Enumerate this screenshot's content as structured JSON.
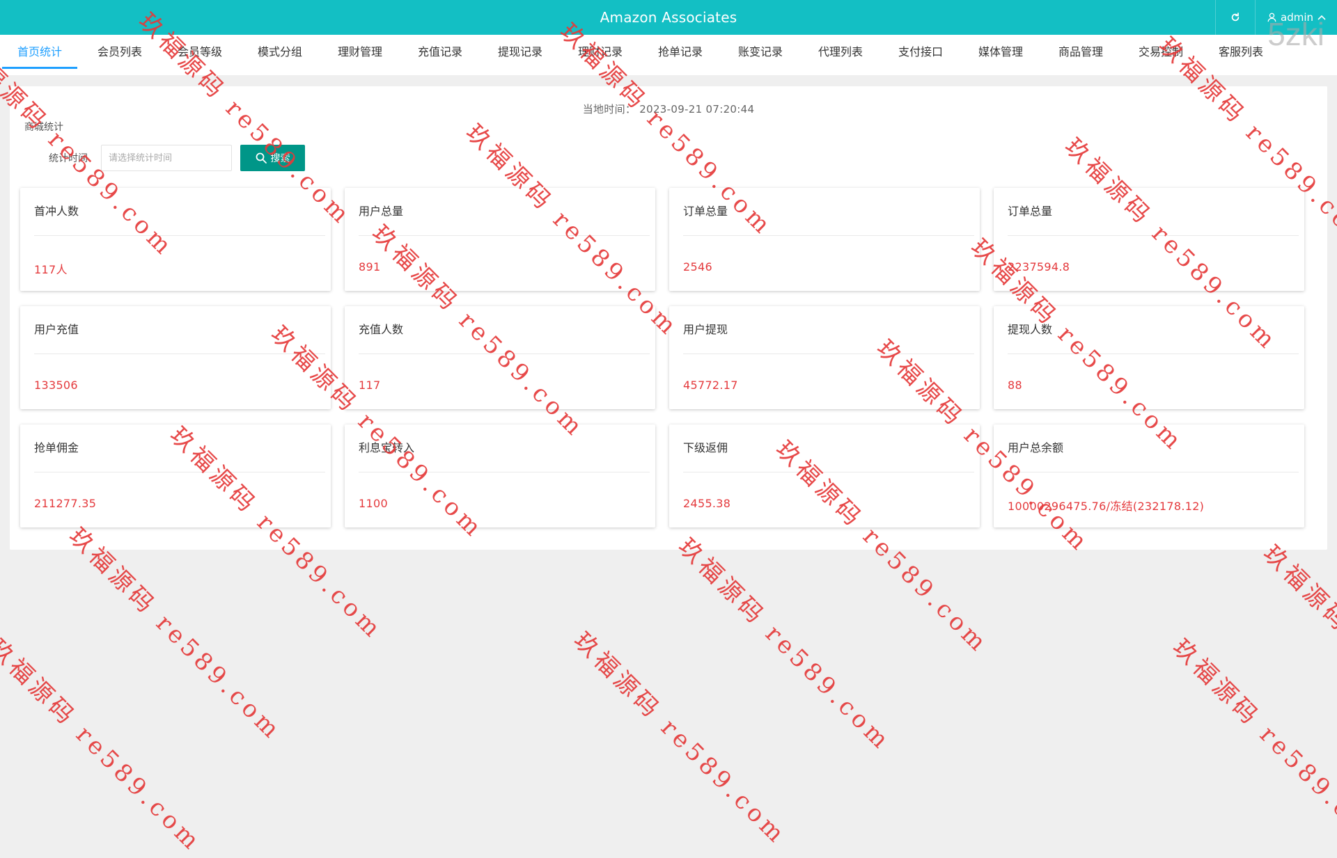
{
  "header": {
    "title": "Amazon Associates",
    "user": "admin"
  },
  "tabs": [
    {
      "label": "首页统计",
      "active": true
    },
    {
      "label": "会员列表"
    },
    {
      "label": "会员等级"
    },
    {
      "label": "模式分组"
    },
    {
      "label": "理财管理"
    },
    {
      "label": "充值记录"
    },
    {
      "label": "提现记录"
    },
    {
      "label": "理财记录"
    },
    {
      "label": "抢单记录"
    },
    {
      "label": "账变记录"
    },
    {
      "label": "代理列表"
    },
    {
      "label": "支付接口"
    },
    {
      "label": "媒体管理"
    },
    {
      "label": "商品管理"
    },
    {
      "label": "交易控制"
    },
    {
      "label": "客服列表"
    }
  ],
  "clock": {
    "label": "当地时间：",
    "value": "2023-09-21 07:20:44"
  },
  "section_label": "商城统计",
  "filter": {
    "label": "统计时间",
    "placeholder": "请选择统计时间",
    "value": ""
  },
  "search_button": "搜索",
  "cards": [
    {
      "title": "首冲人数",
      "value": "117人"
    },
    {
      "title": "用户总量",
      "value": "891"
    },
    {
      "title": "订单总量",
      "value": "2546"
    },
    {
      "title": "订单总量",
      "value": "2237594.8"
    },
    {
      "title": "用户充值",
      "value": "133506"
    },
    {
      "title": "充值人数",
      "value": "117"
    },
    {
      "title": "用户提现",
      "value": "45772.17"
    },
    {
      "title": "提现人数",
      "value": "88"
    },
    {
      "title": "抢单佣金",
      "value": "211277.35"
    },
    {
      "title": "利息宝转入",
      "value": "1100"
    },
    {
      "title": "下级返佣",
      "value": "2455.38"
    },
    {
      "title": "用户总余额",
      "value": "10000296475.76/冻结(232178.12)"
    }
  ],
  "corner_watermark": "5zki",
  "watermark_text": "玖福源码 re589.com",
  "colors": {
    "header": "#13bfc4",
    "active_tab": "#1e9fff",
    "search_button": "#009688",
    "value": "#e4393c",
    "watermark": "#e53a3a"
  }
}
